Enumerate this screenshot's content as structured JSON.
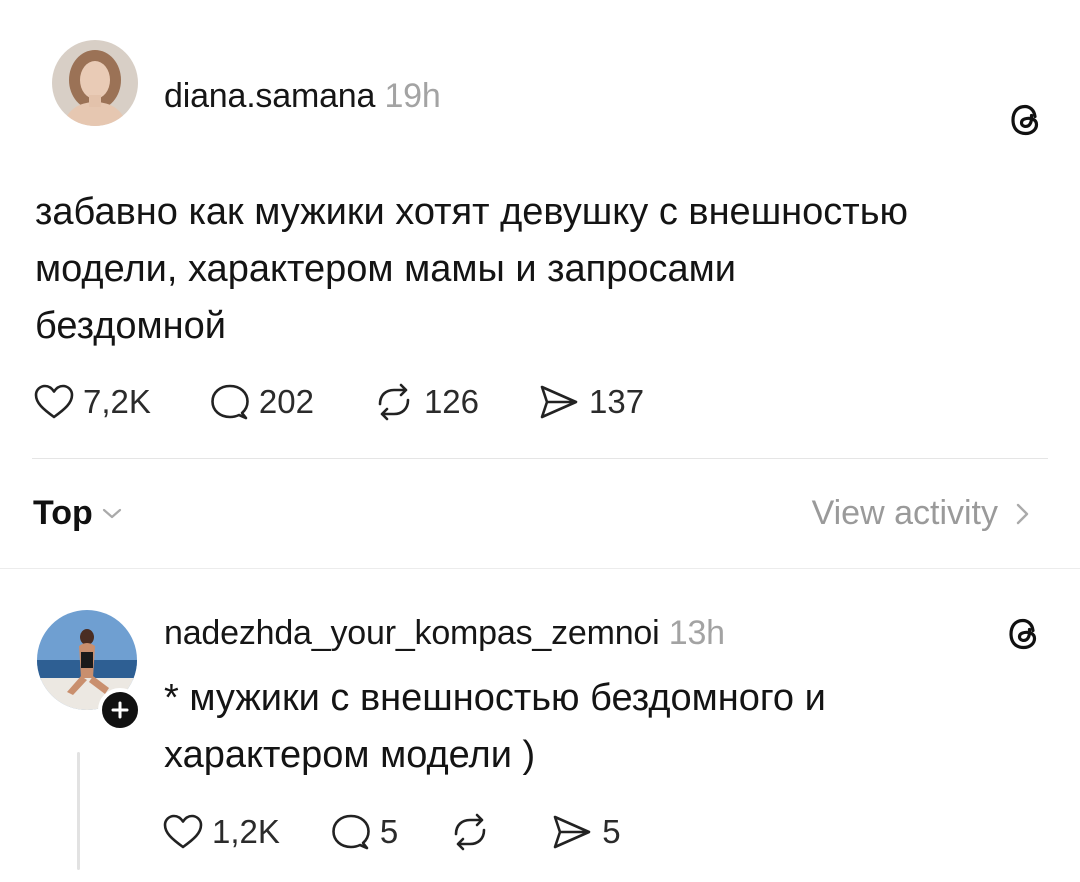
{
  "post": {
    "username": "diana.samana",
    "timestamp": "19h",
    "text_lines": [
      "забавно как мужики хотят девушку с внешностью",
      "модели, характером мамы и запросами",
      "бездомной"
    ],
    "likes": "7,2K",
    "comments": "202",
    "reposts": "126",
    "shares": "137"
  },
  "sort": {
    "label": "Top",
    "view_activity": "View activity"
  },
  "reply": {
    "username": "nadezhda_your_kompas_zemnoi",
    "timestamp": "13h",
    "text_lines": [
      "* мужики с внешностью бездомного и",
      "характером модели )"
    ],
    "likes": "1,2K",
    "comments": "5",
    "reposts": "",
    "shares": "5"
  },
  "icons": {
    "like": "heart-icon",
    "comment": "comment-bubble-icon",
    "repost": "repost-icon",
    "share": "paper-plane-icon",
    "brand": "threads-logo-icon",
    "chevron_down": "chevron-down-icon",
    "chevron_right": "chevron-right-icon",
    "follow": "plus-icon"
  }
}
